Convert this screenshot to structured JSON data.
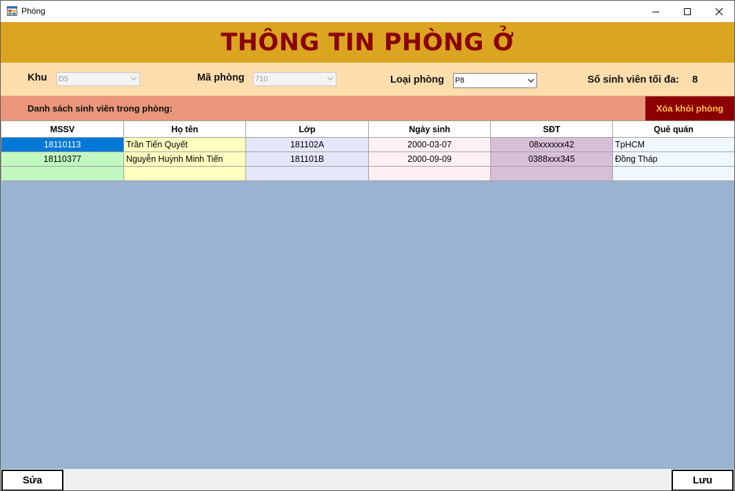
{
  "window": {
    "title": "Phòng"
  },
  "header": {
    "title": "THÔNG TIN PHÒNG Ở"
  },
  "filters": {
    "khu_label": "Khu",
    "khu_value": "D5",
    "ma_phong_label": "Mã phòng",
    "ma_phong_value": "710",
    "loai_phong_label": "Loại phòng",
    "loai_phong_value": "P8",
    "max_students_label": "Số sinh viên tối đa:",
    "max_students_value": "8"
  },
  "list": {
    "title": "Danh sách sinh viên trong phòng:",
    "remove_button": "Xóa khỏi phòng"
  },
  "table": {
    "columns": [
      "MSSV",
      "Họ tên",
      "Lớp",
      "Ngày sinh",
      "SĐT",
      "Quê quán"
    ],
    "rows": [
      [
        "18110113",
        "Trần Tiến Quyết",
        "181102A",
        "2000-03-07",
        "08xxxxxx42",
        "TpHCM"
      ],
      [
        "18110377",
        "Nguyễn Huỳnh Minh Tiến",
        "181101B",
        "2000-09-09",
        "0388xxx345",
        "Đồng Tháp"
      ],
      [
        "",
        "",
        "",
        "",
        "",
        ""
      ]
    ],
    "selected_row": 0
  },
  "footer": {
    "edit_button": "Sửa",
    "save_button": "Lưu"
  },
  "colors": {
    "banner": "#daa520",
    "banner_text": "#8b0000",
    "filter_bg": "#ffdead",
    "list_bar": "#e9967a",
    "remove_button_bg": "#8b0000",
    "grid_bg": "#9ab3d1",
    "selection": "#0078d7"
  }
}
